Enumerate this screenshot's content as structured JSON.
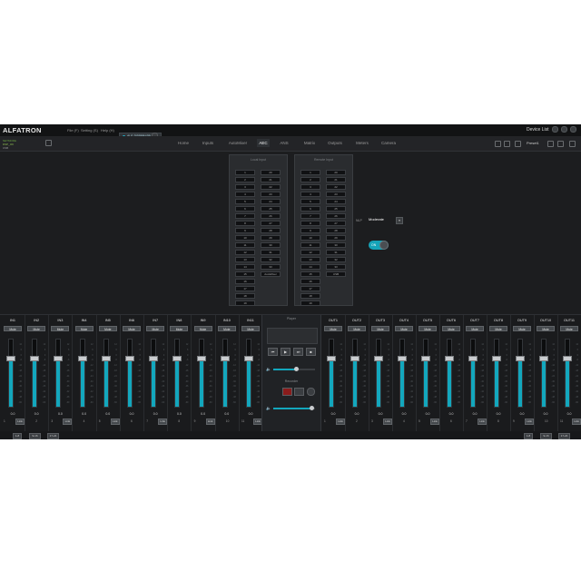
{
  "app": {
    "logo": "ALFATRON",
    "menu": [
      "File (F)",
      "Setting (S)",
      "Help (H)"
    ],
    "device": "ALF-DSP88USB V1.0",
    "device_list": "Device List",
    "status_lines": [
      "NETMODE",
      "DSP_OK",
      "USB"
    ]
  },
  "tabs": [
    {
      "label": "Home",
      "active": false
    },
    {
      "label": "Inputs",
      "active": false
    },
    {
      "label": "AutoMixer",
      "active": false
    },
    {
      "label": "AEC",
      "active": true
    },
    {
      "label": "ANS",
      "active": false
    },
    {
      "label": "Matrix",
      "active": false
    },
    {
      "label": "Outputs",
      "active": false
    },
    {
      "label": "Meters",
      "active": false
    },
    {
      "label": "Camera",
      "active": false
    }
  ],
  "preset": "Preset1",
  "routing": {
    "local": {
      "title": "Local Input",
      "left": [
        "1",
        "2",
        "3",
        "4",
        "5",
        "6",
        "7",
        "8",
        "9",
        "10",
        "11",
        "12",
        "13",
        "14",
        "15",
        "16",
        "17",
        "18",
        "19"
      ],
      "right": [
        "20",
        "21",
        "22",
        "23",
        "24",
        "25",
        "26",
        "27",
        "28",
        "29",
        "30",
        "31",
        "32",
        "33",
        "AutoMixer"
      ]
    },
    "remote": {
      "title": "Remote Input",
      "left": [
        "1",
        "2",
        "3",
        "4",
        "5",
        "6",
        "7",
        "8",
        "9",
        "10",
        "11",
        "12",
        "13",
        "14",
        "15",
        "16",
        "17",
        "18",
        "19"
      ],
      "right": [
        "20",
        "21",
        "22",
        "23",
        "24",
        "25",
        "26",
        "27",
        "28",
        "29",
        "30",
        "31",
        "32",
        "33",
        "USB"
      ]
    }
  },
  "nlp": {
    "label": "NLP",
    "value": "Moderate",
    "button": "▾"
  },
  "aec_toggle": {
    "label": "ON",
    "on": true
  },
  "mixer": {
    "mute_label": "Mute",
    "link_label": "Link",
    "scale": [
      "12",
      "6",
      "0",
      "-6",
      "-12",
      "-18",
      "-24",
      "-30",
      "-36",
      "-42",
      "-48",
      "-60"
    ],
    "inputs": [
      {
        "name": "IN1",
        "vol": "0.0",
        "num": "1"
      },
      {
        "name": "IN2",
        "vol": "0.0",
        "num": "2"
      },
      {
        "name": "IN3",
        "vol": "0.0",
        "num": "3"
      },
      {
        "name": "IN4",
        "vol": "0.0",
        "num": "4"
      },
      {
        "name": "IN5",
        "vol": "0.0",
        "num": "5"
      },
      {
        "name": "IN6",
        "vol": "0.0",
        "num": "6"
      },
      {
        "name": "IN7",
        "vol": "0.0",
        "num": "7"
      },
      {
        "name": "IN8",
        "vol": "0.0",
        "num": "8"
      },
      {
        "name": "IN9",
        "vol": "0.0",
        "num": "9"
      },
      {
        "name": "IN10",
        "vol": "0.0",
        "num": "10"
      },
      {
        "name": "IN11",
        "vol": "0.0",
        "num": "11"
      }
    ],
    "outputs": [
      {
        "name": "OUT1",
        "vol": "0.0",
        "num": "1"
      },
      {
        "name": "OUT2",
        "vol": "0.0",
        "num": "2"
      },
      {
        "name": "OUT3",
        "vol": "0.0",
        "num": "3"
      },
      {
        "name": "OUT4",
        "vol": "0.0",
        "num": "4"
      },
      {
        "name": "OUT5",
        "vol": "0.0",
        "num": "5"
      },
      {
        "name": "OUT6",
        "vol": "0.0",
        "num": "6"
      },
      {
        "name": "OUT7",
        "vol": "0.0",
        "num": "7"
      },
      {
        "name": "OUT8",
        "vol": "0.0",
        "num": "8"
      },
      {
        "name": "OUT9",
        "vol": "0.0",
        "num": "9"
      },
      {
        "name": "OUT10",
        "vol": "0.0",
        "num": "10"
      },
      {
        "name": "OUT11",
        "vol": "0.0",
        "num": "11"
      }
    ],
    "fader_level": 0.72
  },
  "player": {
    "title": "Player",
    "controls": [
      "⏮",
      "▶",
      "⏭",
      "■"
    ],
    "recorder_title": "Recorder",
    "volume_level": 0.55,
    "recorder_volume_level": 0.92
  },
  "bottom": {
    "left": [
      "1-8",
      "9-16",
      "17-24"
    ],
    "right": [
      "1-8",
      "9-16",
      "17-24"
    ]
  },
  "colors": {
    "accent": "#13a7bd",
    "background": "#1c1d1f"
  }
}
